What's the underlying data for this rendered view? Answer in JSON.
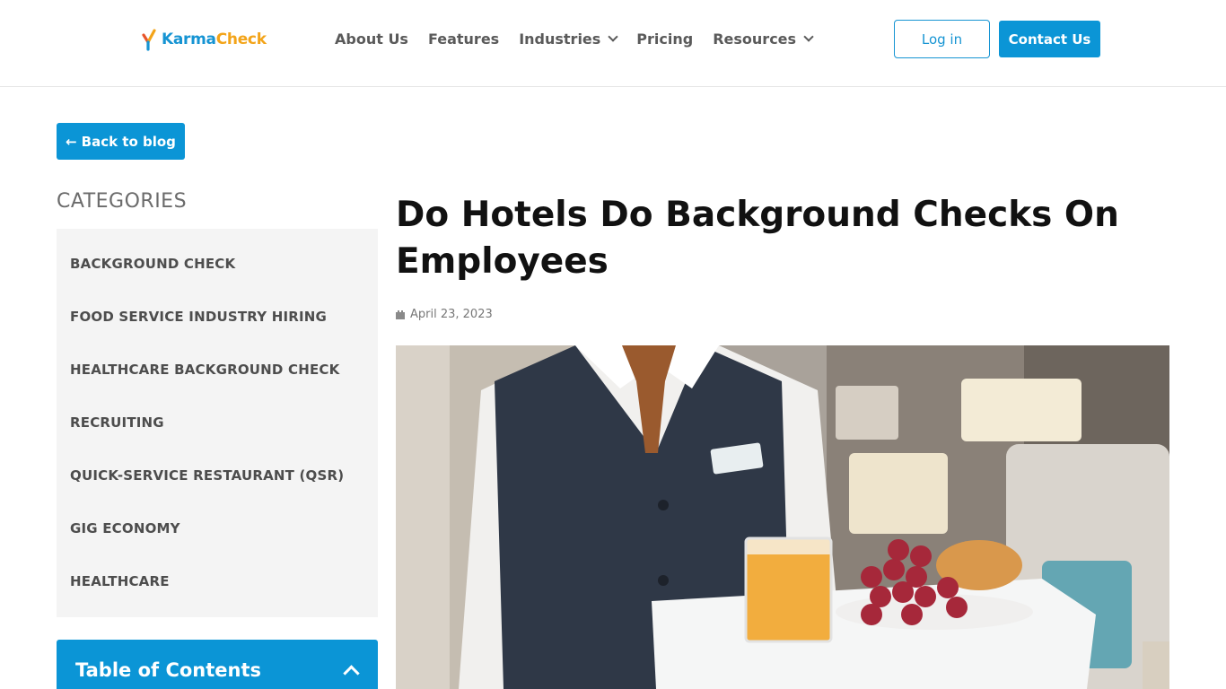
{
  "brand": {
    "name_part1": "Karma",
    "name_part2": "Check"
  },
  "nav": {
    "items": [
      {
        "label": "About Us",
        "has_dropdown": false
      },
      {
        "label": "Features",
        "has_dropdown": false
      },
      {
        "label": "Industries",
        "has_dropdown": true
      },
      {
        "label": "Pricing",
        "has_dropdown": false
      },
      {
        "label": "Resources",
        "has_dropdown": true
      }
    ],
    "login_label": "Log in",
    "contact_label": "Contact Us"
  },
  "back_button": {
    "arrow": "←",
    "label": "Back to blog"
  },
  "sidebar": {
    "categories_heading": "CATEGORIES",
    "categories": [
      "BACKGROUND CHECK",
      "FOOD SERVICE INDUSTRY HIRING",
      "HEALTHCARE BACKGROUND CHECK",
      "RECRUITING",
      "QUICK-SERVICE RESTAURANT (QSR)",
      "GIG ECONOMY",
      "HEALTHCARE"
    ],
    "toc_title": "Table of Contents"
  },
  "article": {
    "title_line1": "Do Hotels Do Background Checks On",
    "title_line2": "Employees",
    "date": "April 23, 2023",
    "hero_icon": "hotel-waiter-serving-breakfast-image"
  },
  "colors": {
    "accent": "#0b95d6",
    "brand_blue": "#1694d3",
    "brand_orange": "#f3a419",
    "sidebar_bg": "#f4f4f4"
  }
}
